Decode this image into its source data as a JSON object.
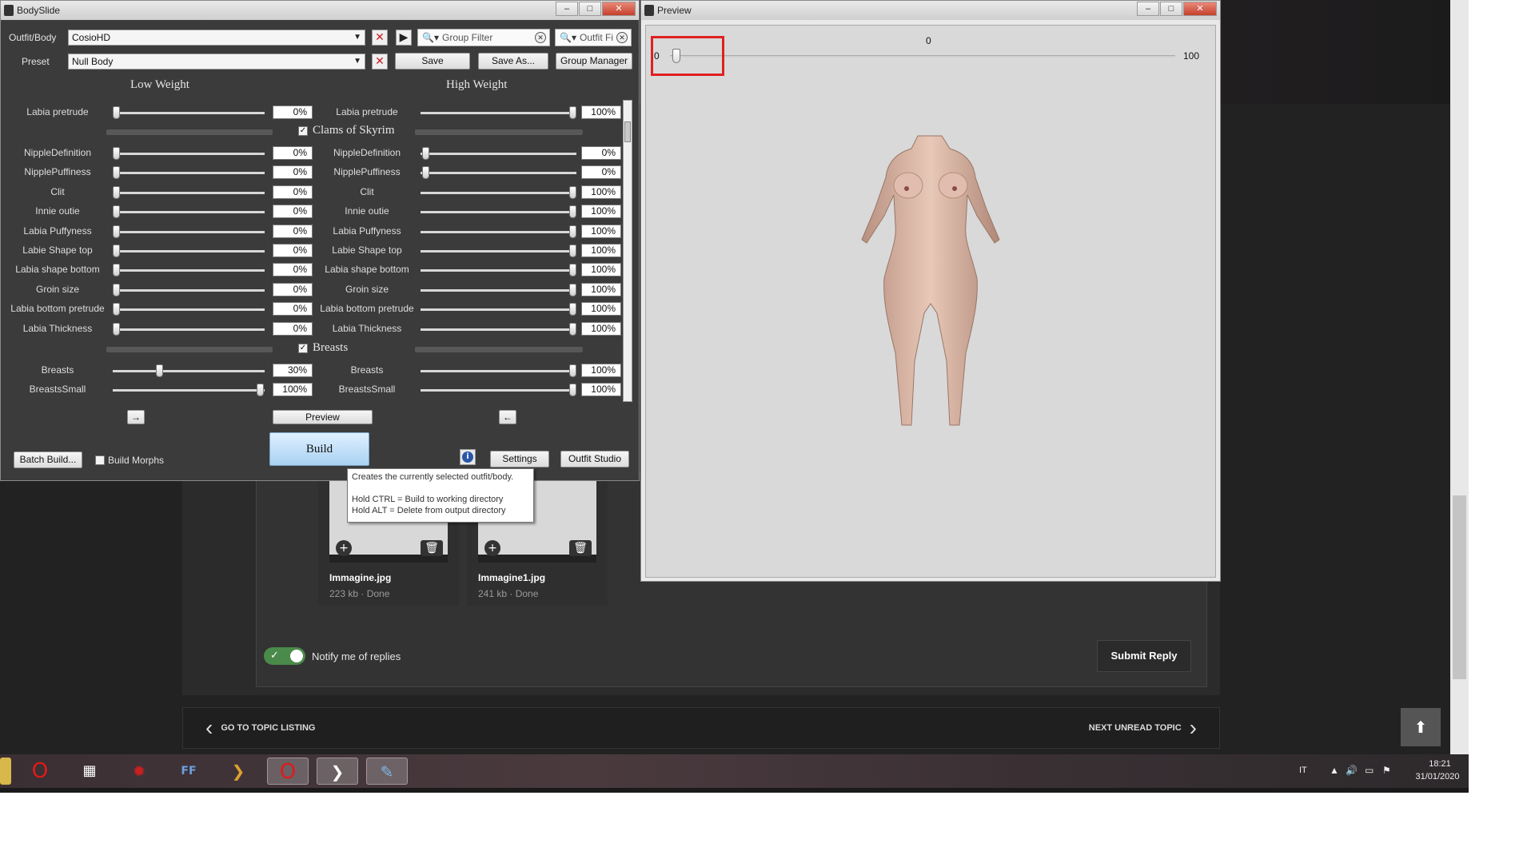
{
  "bodyslide": {
    "title": "BodySlide",
    "outfit_label": "Outfit/Body",
    "outfit_value": "CosioHD",
    "preset_label": "Preset",
    "preset_value": "Null Body",
    "group_filter_placeholder": "Group Filter",
    "outfit_filter_placeholder": "Outfit Fi",
    "save_label": "Save",
    "save_as_label": "Save As...",
    "group_manager_label": "Group Manager",
    "low_weight_label": "Low Weight",
    "high_weight_label": "High Weight",
    "top_row": {
      "low_label": "Labia pretrude",
      "low_value": "0%",
      "low_pct": 0,
      "high_label": "Labia pretrude",
      "high_value": "100%",
      "high_pct": 100
    },
    "group1": {
      "name": "Clams of Skyrim",
      "checked": true
    },
    "group1_rows": [
      {
        "low_label": "NippleDefinition",
        "low_value": "0%",
        "low_pct": 0,
        "high_label": "NippleDefinition",
        "high_value": "0%",
        "high_pct": 0
      },
      {
        "low_label": "NipplePuffiness",
        "low_value": "0%",
        "low_pct": 0,
        "high_label": "NipplePuffiness",
        "high_value": "0%",
        "high_pct": 0
      },
      {
        "low_label": "Clit",
        "low_value": "0%",
        "low_pct": 0,
        "high_label": "Clit",
        "high_value": "100%",
        "high_pct": 100
      },
      {
        "low_label": "Innie outie",
        "low_value": "0%",
        "low_pct": 0,
        "high_label": "Innie outie",
        "high_value": "100%",
        "high_pct": 100
      },
      {
        "low_label": "Labia Puffyness",
        "low_value": "0%",
        "low_pct": 0,
        "high_label": "Labia Puffyness",
        "high_value": "100%",
        "high_pct": 100
      },
      {
        "low_label": "Labie Shape top",
        "low_value": "0%",
        "low_pct": 0,
        "high_label": "Labie Shape top",
        "high_value": "100%",
        "high_pct": 100
      },
      {
        "low_label": "Labia shape bottom",
        "low_value": "0%",
        "low_pct": 0,
        "high_label": "Labia shape bottom",
        "high_value": "100%",
        "high_pct": 100
      },
      {
        "low_label": "Groin size",
        "low_value": "0%",
        "low_pct": 0,
        "high_label": "Groin size",
        "high_value": "100%",
        "high_pct": 100
      },
      {
        "low_label": "Labia bottom pretrude",
        "low_value": "0%",
        "low_pct": 0,
        "high_label": "Labia bottom pretrude",
        "high_value": "100%",
        "high_pct": 100
      },
      {
        "low_label": "Labia Thickness",
        "low_value": "0%",
        "low_pct": 0,
        "high_label": "Labia Thickness",
        "high_value": "100%",
        "high_pct": 100
      }
    ],
    "group2": {
      "name": "Breasts",
      "checked": true
    },
    "group2_rows": [
      {
        "low_label": "Breasts",
        "low_value": "30%",
        "low_pct": 30,
        "high_label": "Breasts",
        "high_value": "100%",
        "high_pct": 100
      },
      {
        "low_label": "BreastsSmall",
        "low_value": "100%",
        "low_pct": 100,
        "high_label": "BreastsSmall",
        "high_value": "100%",
        "high_pct": 100
      }
    ],
    "arrow_right": "→",
    "arrow_left": "←",
    "preview_label": "Preview",
    "build_label": "Build",
    "batch_build_label": "Batch Build...",
    "build_morphs_label": "Build Morphs",
    "build_morphs_checked": false,
    "settings_label": "Settings",
    "outfit_studio_label": "Outfit Studio",
    "tooltip_lines": [
      "Creates the currently selected outfit/body.",
      "",
      "Hold CTRL = Build to working directory",
      "Hold ALT = Delete from output directory"
    ]
  },
  "preview": {
    "title": "Preview",
    "weight_current": "0",
    "weight_min": "0",
    "weight_max": "100",
    "weight_pct": 0
  },
  "forum": {
    "attachments": [
      {
        "name": "Immagine.jpg",
        "meta": "223 kb · Done"
      },
      {
        "name": "Immagine1.jpg",
        "meta": "241 kb · Done"
      }
    ],
    "notify_label": "Notify me of replies",
    "submit_label": "Submit Reply",
    "prev_topic_label": "GO TO TOPIC LISTING",
    "next_topic_label": "NEXT UNREAD TOPIC"
  },
  "taskbar": {
    "lang": "IT",
    "time": "18:21",
    "date": "31/01/2020",
    "icons": [
      "opera-icon",
      "media-icon",
      "settings-wheel-icon",
      "ffdec-icon",
      "bodyslide-pinned-icon",
      "opera-active-icon",
      "bodyslide-active-icon",
      "paint-active-icon"
    ]
  },
  "colors": {
    "accent_red": "#e02020",
    "build_blue": "#a9d2f2"
  }
}
